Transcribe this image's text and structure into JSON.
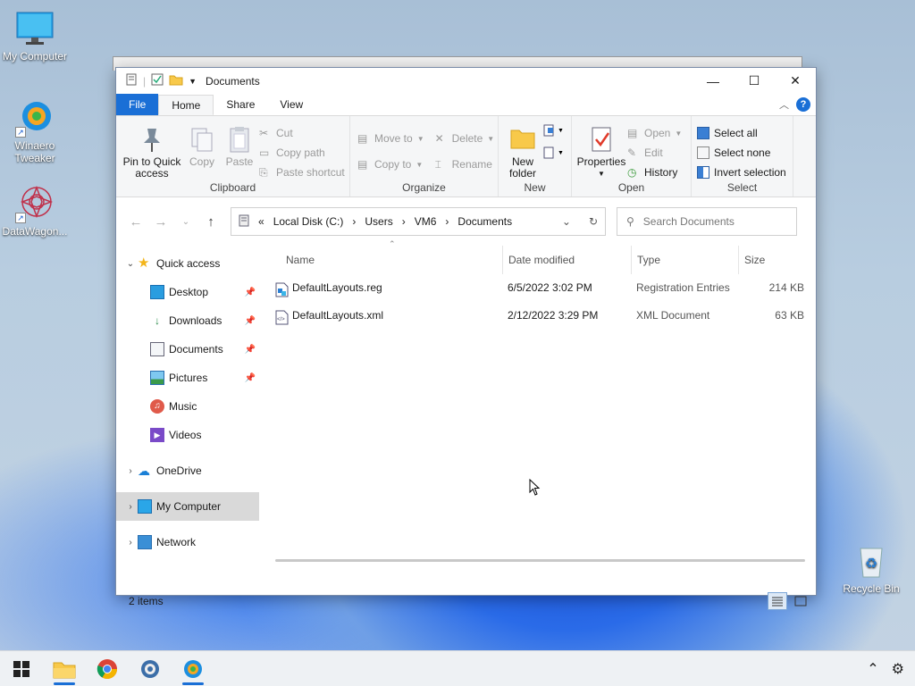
{
  "desktop": {
    "icons": [
      {
        "label": "My Computer"
      },
      {
        "label": "Winaero Tweaker"
      },
      {
        "label": "DataWagon..."
      },
      {
        "label": "Recycle Bin"
      }
    ]
  },
  "window": {
    "title": "Documents",
    "tabs": [
      {
        "label": "File"
      },
      {
        "label": "Home"
      },
      {
        "label": "Share"
      },
      {
        "label": "View"
      }
    ],
    "ribbon": {
      "clipboard": {
        "label": "Clipboard",
        "pin": "Pin to Quick access",
        "copy": "Copy",
        "paste": "Paste",
        "cut": "Cut",
        "copy_path": "Copy path",
        "paste_shortcut": "Paste shortcut"
      },
      "organize": {
        "label": "Organize",
        "move_to": "Move to",
        "copy_to": "Copy to",
        "delete": "Delete",
        "rename": "Rename"
      },
      "new": {
        "label": "New",
        "new_folder": "New folder"
      },
      "open": {
        "label": "Open",
        "properties": "Properties",
        "open": "Open",
        "edit": "Edit",
        "history": "History"
      },
      "select": {
        "label": "Select",
        "select_all": "Select all",
        "select_none": "Select none",
        "invert": "Invert selection"
      }
    },
    "address": {
      "prefix": "«",
      "crumbs": [
        "Local Disk (C:)",
        "Users",
        "VM6",
        "Documents"
      ],
      "search_placeholder": "Search Documents"
    },
    "nav": {
      "quick_access": "Quick access",
      "items": [
        {
          "label": "Desktop"
        },
        {
          "label": "Downloads"
        },
        {
          "label": "Documents"
        },
        {
          "label": "Pictures"
        },
        {
          "label": "Music"
        },
        {
          "label": "Videos"
        }
      ],
      "onedrive": "OneDrive",
      "my_computer": "My Computer",
      "network": "Network"
    },
    "columns": {
      "name": "Name",
      "date": "Date modified",
      "type": "Type",
      "size": "Size"
    },
    "files": [
      {
        "name": "DefaultLayouts.reg",
        "date": "6/5/2022 3:02 PM",
        "type": "Registration Entries",
        "size": "214 KB"
      },
      {
        "name": "DefaultLayouts.xml",
        "date": "2/12/2022 3:29 PM",
        "type": "XML Document",
        "size": "63 KB"
      }
    ],
    "status": "2 items"
  },
  "colors": {
    "accent": "#1a6fd6"
  }
}
